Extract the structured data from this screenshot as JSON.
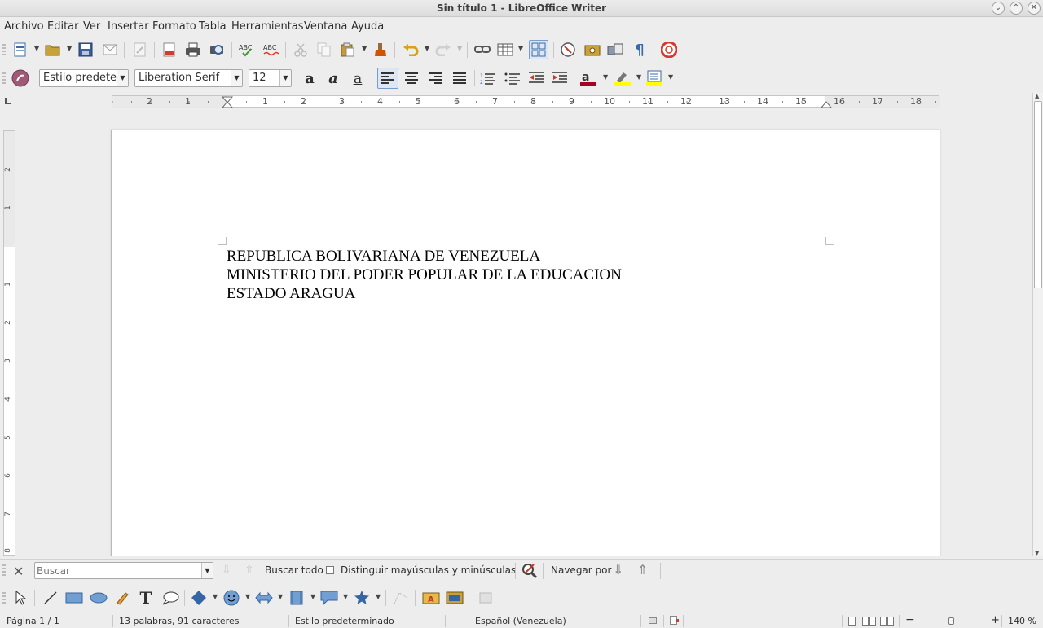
{
  "window": {
    "title": "Sin título 1 - LibreOffice Writer"
  },
  "menu": {
    "items": [
      "Archivo",
      "Editar",
      "Ver",
      "Insertar",
      "Formato",
      "Tabla",
      "Herramientas",
      "Ventana",
      "Ayuda"
    ]
  },
  "format_toolbar": {
    "paragraph_style": "Estilo predeterminado",
    "font_name": "Liberation Serif",
    "font_size": "12"
  },
  "ruler": {
    "h_labels": [
      "2",
      "1",
      "1",
      "2",
      "3",
      "4",
      "5",
      "6",
      "7",
      "8",
      "9",
      "10",
      "11",
      "12",
      "13",
      "14",
      "15",
      "16",
      "17",
      "18"
    ],
    "v_labels": [
      "2",
      "1",
      "1",
      "2",
      "3",
      "4",
      "5",
      "6",
      "7",
      "8"
    ]
  },
  "document": {
    "lines": [
      "REPUBLICA BOLIVARIANA DE VENEZUELA",
      "MINISTERIO DEL PODER POPULAR DE LA EDUCACION",
      "ESTADO ARAGUA"
    ]
  },
  "findbar": {
    "placeholder": "Buscar",
    "find_all": "Buscar todo",
    "match_case": "Distinguir mayúsculas y minúsculas",
    "navigate_by": "Navegar por"
  },
  "status": {
    "page": "Página 1 / 1",
    "word_count": "13 palabras, 91 caracteres",
    "page_style": "Estilo predeterminado",
    "language": "Español (Venezuela)",
    "zoom": "140 %"
  },
  "colors": {
    "font_color": "#a50021",
    "highlight_color": "#ffff00",
    "toolbar_bg": "#ededed"
  }
}
